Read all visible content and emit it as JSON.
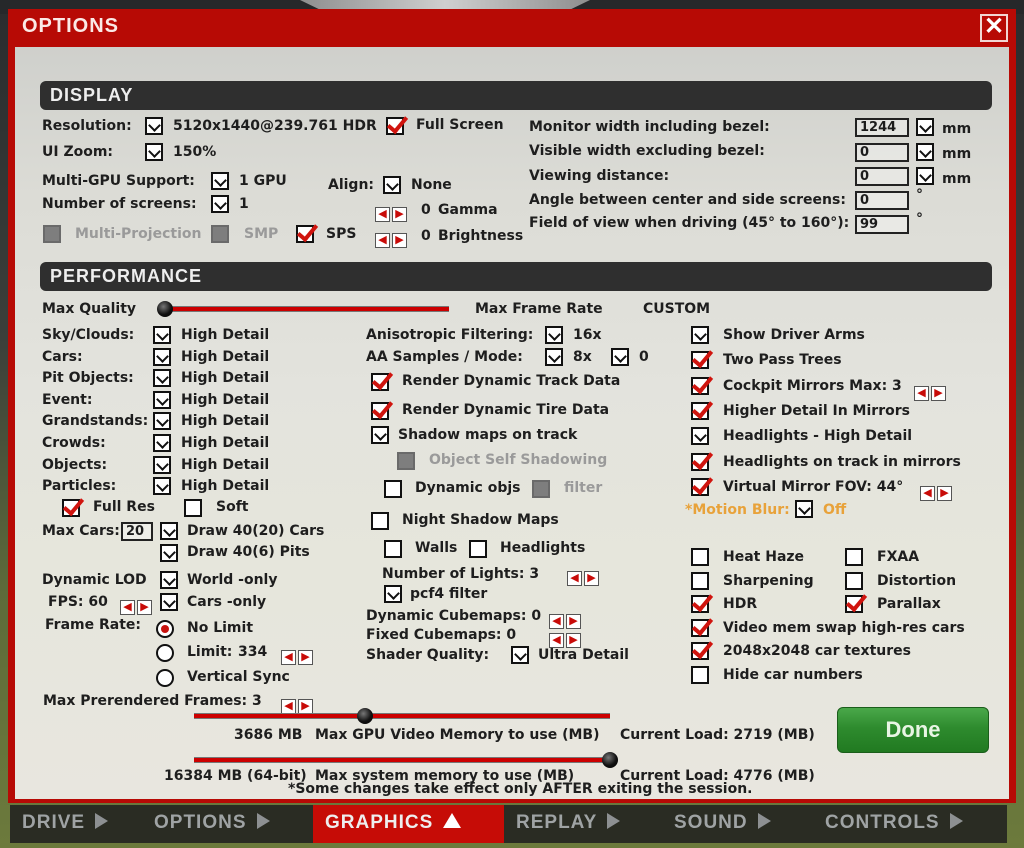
{
  "window": {
    "title": "OPTIONS",
    "close_icon": "close-x-icon"
  },
  "display": {
    "heading": "DISPLAY",
    "resolution_label": "Resolution:",
    "resolution_value": "5120x1440@239.761 HDR",
    "fullscreen_label": "Full Screen",
    "fullscreen_checked": true,
    "ui_zoom_label": "UI Zoom:",
    "ui_zoom_value": "150%",
    "multigpu_label": "Multi-GPU Support:",
    "multigpu_value": "1 GPU",
    "screens_label": "Number of screens:",
    "screens_value": "1",
    "align_label": "Align:",
    "align_value": "None",
    "gamma_value": "0",
    "gamma_label": "Gamma",
    "brightness_value": "0",
    "brightness_label": "Brightness",
    "multiprojection_label": "Multi-Projection",
    "smp_label": "SMP",
    "sps_label": "SPS",
    "sps_checked": true,
    "monitor_width_label": "Monitor width including bezel:",
    "monitor_width_value": "1244",
    "visible_width_label": "Visible width excluding bezel:",
    "visible_width_value": "0",
    "viewing_distance_label": "Viewing distance:",
    "viewing_distance_value": "0",
    "angle_label": "Angle between center and side screens:",
    "angle_value": "0",
    "fov_label": "Field of view when driving (45° to 160°):",
    "fov_value": "99",
    "unit_mm": "mm",
    "unit_deg": "°"
  },
  "performance": {
    "heading": "PERFORMANCE",
    "max_quality_label": "Max Quality",
    "max_framerate_label": "Max Frame Rate",
    "preset_value": "CUSTOM",
    "quality_slider_position": 0,
    "detail_rows": [
      {
        "label": "Sky/Clouds:",
        "value": "High Detail"
      },
      {
        "label": "Cars:",
        "value": "High Detail"
      },
      {
        "label": "Pit Objects:",
        "value": "High Detail"
      },
      {
        "label": "Event:",
        "value": "High Detail"
      },
      {
        "label": "Grandstands:",
        "value": "High Detail"
      },
      {
        "label": "Crowds:",
        "value": "High Detail"
      },
      {
        "label": "Objects:",
        "value": "High Detail"
      },
      {
        "label": "Particles:",
        "value": "High Detail"
      }
    ],
    "full_res_label": "Full Res",
    "soft_label": "Soft",
    "max_cars_label": "Max Cars:",
    "max_cars_value": "20",
    "draw_cars_value": "Draw 40(20) Cars",
    "draw_pits_value": "Draw 40(6) Pits",
    "dynamic_lod_label": "Dynamic LOD",
    "world_only_value": "World -only",
    "fps_label": "FPS: 60",
    "cars_only_value": "Cars -only",
    "frame_rate_label": "Frame Rate:",
    "frame_rate_options": [
      "No Limit",
      "Limit:",
      "Vertical Sync"
    ],
    "frame_rate_selected": "No Limit",
    "frame_limit_value": "334",
    "prerendered_label": "Max Prerendered Frames: 3",
    "aniso_label": "Anisotropic Filtering:",
    "aniso_value": "16x",
    "aa_label": "AA Samples / Mode:",
    "aa_samples_value": "8x",
    "aa_mode_value": "0",
    "render_track_label": "Render Dynamic Track Data",
    "render_tire_label": "Render Dynamic Tire Data",
    "shadow_maps_label": "Shadow maps on track",
    "self_shadow_label": "Object Self Shadowing",
    "dynamic_objs_label": "Dynamic objs",
    "filter_label": "filter",
    "night_shadow_label": "Night Shadow Maps",
    "walls_label": "Walls",
    "headlights_label": "Headlights",
    "num_lights_label": "Number of Lights: 3",
    "pcf4_label": "pcf4 filter",
    "dyn_cubemaps_label": "Dynamic Cubemaps: 0",
    "fixed_cubemaps_label": "Fixed Cubemaps: 0",
    "shader_label": "Shader Quality:",
    "shader_value": "Ultra Detail",
    "right_options": [
      {
        "label": "Show Driver Arms",
        "state": "dropdown"
      },
      {
        "label": "Two Pass Trees",
        "state": "checked"
      },
      {
        "label": "Cockpit Mirrors  Max:  3",
        "state": "checked"
      },
      {
        "label": "Higher Detail In Mirrors",
        "state": "checked"
      },
      {
        "label": "Headlights - High Detail",
        "state": "dropdown"
      },
      {
        "label": "Headlights on track in mirrors",
        "state": "checked"
      },
      {
        "label": "Virtual Mirror   FOV:  44°",
        "state": "checked"
      }
    ],
    "motion_blur_label": "*Motion Blur:",
    "motion_blur_value": "Off",
    "effects": [
      {
        "label": "Heat Haze",
        "checked": false
      },
      {
        "label": "FXAA",
        "checked": false
      },
      {
        "label": "Sharpening",
        "checked": false
      },
      {
        "label": "Distortion",
        "checked": false
      },
      {
        "label": "HDR",
        "checked": true
      },
      {
        "label": "Parallax",
        "checked": true
      },
      {
        "label": "Video mem swap high-res cars",
        "checked": true
      },
      {
        "label": "2048x2048 car textures",
        "checked": true
      },
      {
        "label": "Hide car numbers",
        "checked": false
      }
    ],
    "gpu_mem_value": "3686 MB",
    "gpu_mem_label": "Max GPU Video Memory to use (MB)",
    "gpu_mem_fraction": 0.41,
    "gpu_load": "Current Load: 2719 (MB)",
    "sys_mem_value": "16384 MB (64-bit)",
    "sys_mem_label": "Max system memory to use (MB)",
    "sys_mem_fraction": 1.0,
    "sys_load": "Current Load: 4776 (MB)",
    "note": "*Some changes take effect only AFTER exiting the session."
  },
  "done_label": "Done",
  "nav": [
    {
      "label": "DRIVE",
      "active": false
    },
    {
      "label": "OPTIONS",
      "active": false
    },
    {
      "label": "GRAPHICS",
      "active": true
    },
    {
      "label": "REPLAY",
      "active": false
    },
    {
      "label": "SOUND",
      "active": false
    },
    {
      "label": "CONTROLS",
      "active": false
    }
  ]
}
